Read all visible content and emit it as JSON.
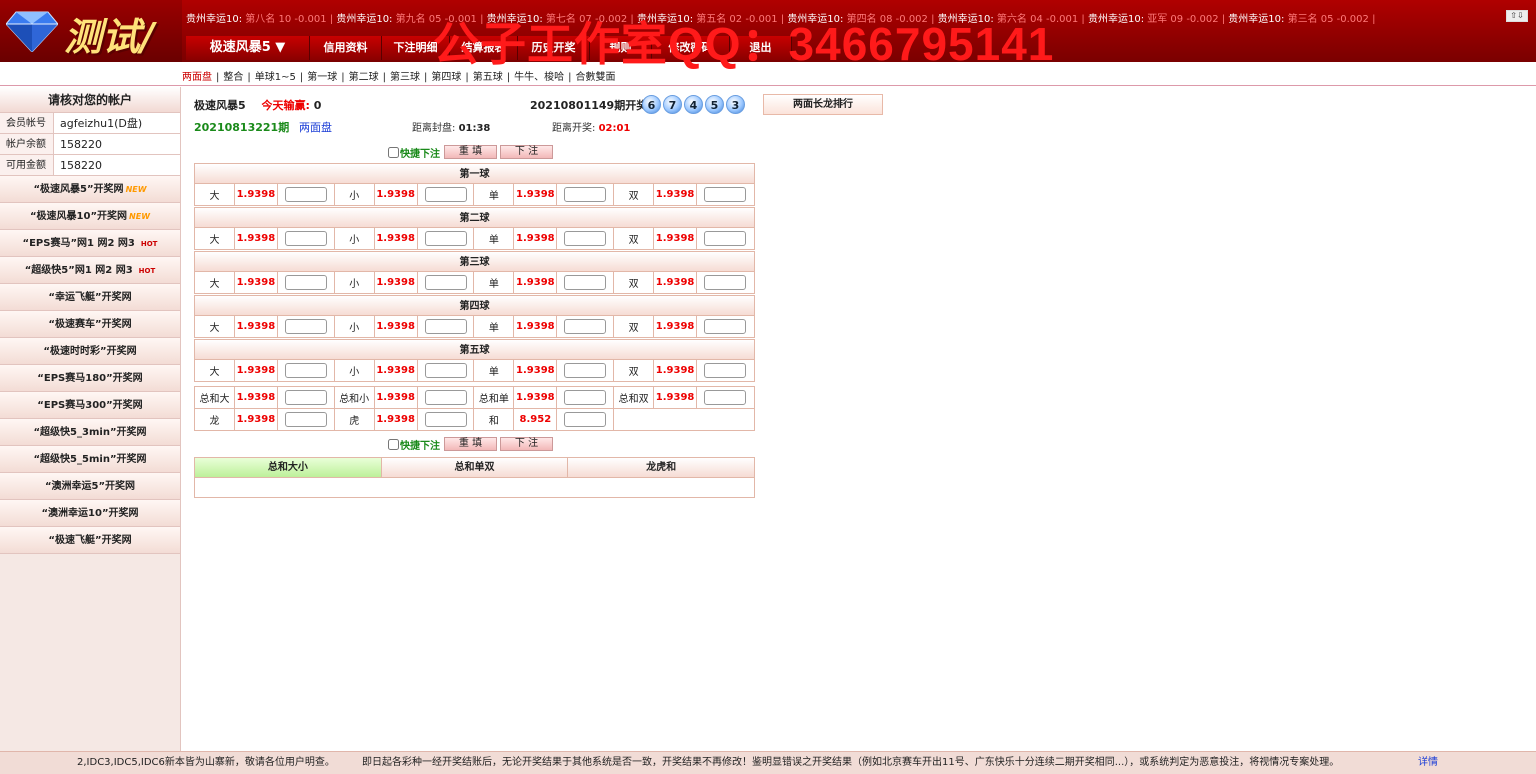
{
  "header": {
    "logo_text": "测试/",
    "watermark": "公子工作室QQ：3466795141",
    "corner_btn": "⇧⇩",
    "ticker": [
      {
        "name": "贵州幸运10:",
        "val": " 第八名 10 -0.001"
      },
      {
        "name": "贵州幸运10:",
        "val": " 第九名 05 -0.001"
      },
      {
        "name": "贵州幸运10:",
        "val": " 第七名 07 -0.002"
      },
      {
        "name": "贵州幸运10:",
        "val": " 第五名 02 -0.001"
      },
      {
        "name": "贵州幸运10:",
        "val": " 第四名 08 -0.002"
      },
      {
        "name": "贵州幸运10:",
        "val": " 第六名 04 -0.001"
      },
      {
        "name": "贵州幸运10:",
        "val": " 亚军 09 -0.002"
      },
      {
        "name": "贵州幸运10:",
        "val": " 第三名 05 -0.002"
      }
    ]
  },
  "nav": [
    {
      "label": "极速风暴5 ▼"
    },
    {
      "label": "信用资料"
    },
    {
      "label": "下注明细"
    },
    {
      "label": "结算报表"
    },
    {
      "label": "历史开奖"
    },
    {
      "label": "规则"
    },
    {
      "label": "修改密码"
    },
    {
      "label": "退出"
    }
  ],
  "subnav": [
    "两面盘",
    "整合",
    "单球1~5",
    "第一球",
    "第二球",
    "第三球",
    "第四球",
    "第五球",
    "牛牛、梭哈",
    "合數雙面"
  ],
  "sidebar": {
    "title": "请核对您的帐户",
    "account": [
      {
        "k": "会员帐号",
        "v": "agfeizhu1(D盘)"
      },
      {
        "k": "帐户余额",
        "v": "158220"
      },
      {
        "k": "可用金额",
        "v": "158220"
      }
    ],
    "links": [
      {
        "label": "“极速风暴5”开奖网",
        "tag": "NEW",
        "tag_type": "new"
      },
      {
        "label": "“极速风暴10”开奖网",
        "tag": "NEW",
        "tag_type": "new"
      },
      {
        "label": "“EPS赛马”网1 网2 网3",
        "tag": "HOT",
        "tag_type": "hot"
      },
      {
        "label": "“超级快5”网1 网2 网3",
        "tag": "HOT",
        "tag_type": "hot"
      },
      {
        "label": "“幸运飞艇”开奖网",
        "tag": "",
        "tag_type": ""
      },
      {
        "label": "“极速赛车”开奖网",
        "tag": "",
        "tag_type": ""
      },
      {
        "label": "“极速时时彩”开奖网",
        "tag": "",
        "tag_type": ""
      },
      {
        "label": "“EPS赛马180”开奖网",
        "tag": "",
        "tag_type": ""
      },
      {
        "label": "“EPS赛马300”开奖网",
        "tag": "",
        "tag_type": ""
      },
      {
        "label": "“超级快5_3min”开奖网",
        "tag": "",
        "tag_type": ""
      },
      {
        "label": "“超级快5_5min”开奖网",
        "tag": "",
        "tag_type": ""
      },
      {
        "label": "“澳洲幸运5”开奖网",
        "tag": "",
        "tag_type": ""
      },
      {
        "label": "“澳洲幸运10”开奖网",
        "tag": "",
        "tag_type": ""
      },
      {
        "label": "“极速飞艇”开奖网",
        "tag": "",
        "tag_type": ""
      }
    ]
  },
  "main": {
    "game": "极速风暴5",
    "win_label": "今天输赢:",
    "win_value": "0",
    "last_issue": "20210801149期开奖",
    "balls": [
      "6",
      "7",
      "4",
      "5",
      "3"
    ],
    "rank_button": "两面长龙排行",
    "current_issue": "20210813221期",
    "mode": "两面盘",
    "close_label": "距离封盘:",
    "close_time": "01:38",
    "open_label": "距离开奖:",
    "open_time": "02:01",
    "quick_label": "快捷下注",
    "reset_label": "重 填",
    "submit_label": "下 注",
    "balls_sections": [
      {
        "title": "第一球",
        "items": [
          {
            "label": "大",
            "odds": "1.9398"
          },
          {
            "label": "小",
            "odds": "1.9398"
          },
          {
            "label": "单",
            "odds": "1.9398"
          },
          {
            "label": "双",
            "odds": "1.9398"
          }
        ]
      },
      {
        "title": "第二球",
        "items": [
          {
            "label": "大",
            "odds": "1.9398"
          },
          {
            "label": "小",
            "odds": "1.9398"
          },
          {
            "label": "单",
            "odds": "1.9398"
          },
          {
            "label": "双",
            "odds": "1.9398"
          }
        ]
      },
      {
        "title": "第三球",
        "items": [
          {
            "label": "大",
            "odds": "1.9398"
          },
          {
            "label": "小",
            "odds": "1.9398"
          },
          {
            "label": "单",
            "odds": "1.9398"
          },
          {
            "label": "双",
            "odds": "1.9398"
          }
        ]
      },
      {
        "title": "第四球",
        "items": [
          {
            "label": "大",
            "odds": "1.9398"
          },
          {
            "label": "小",
            "odds": "1.9398"
          },
          {
            "label": "单",
            "odds": "1.9398"
          },
          {
            "label": "双",
            "odds": "1.9398"
          }
        ]
      },
      {
        "title": "第五球",
        "items": [
          {
            "label": "大",
            "odds": "1.9398"
          },
          {
            "label": "小",
            "odds": "1.9398"
          },
          {
            "label": "单",
            "odds": "1.9398"
          },
          {
            "label": "双",
            "odds": "1.9398"
          }
        ]
      }
    ],
    "total_rows": [
      [
        {
          "label": "总和大",
          "odds": "1.9398"
        },
        {
          "label": "总和小",
          "odds": "1.9398"
        },
        {
          "label": "总和单",
          "odds": "1.9398"
        },
        {
          "label": "总和双",
          "odds": "1.9398"
        }
      ],
      [
        {
          "label": "龙",
          "odds": "1.9398"
        },
        {
          "label": "虎",
          "odds": "1.9398"
        },
        {
          "label": "和",
          "odds": "8.952"
        }
      ]
    ],
    "stats_tabs": [
      "总和大小",
      "总和单双",
      "龙虎和"
    ]
  },
  "footer": {
    "text1": "2,IDC3,IDC5,IDC6新本皆为山寨新，敬请各位用户明查。",
    "text2": "即日起各彩种一经开奖结账后，无论开奖结果于其他系统是否一致，开奖结果不再修改！鉴明显错误之开奖结果（例如北京赛车开出11号、广东快乐十分连续二期开奖相同...），或系统判定为恶意投注，将视情况专案处理。",
    "more": "详情"
  },
  "colors": {
    "brand": "#b00000",
    "odds": "#ee0000",
    "link": "#1a3cd6",
    "green": "#1a8a1a"
  }
}
